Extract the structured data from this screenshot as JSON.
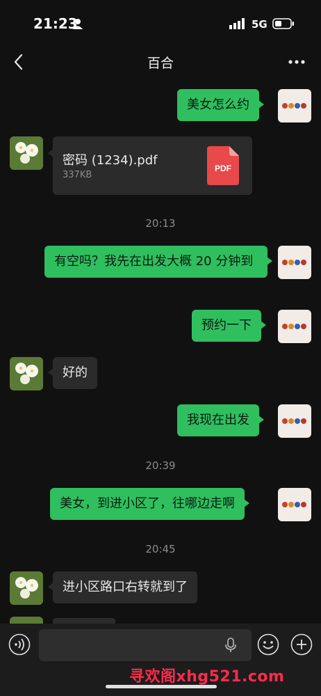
{
  "status_bar": {
    "time": "21:23",
    "network": "5G"
  },
  "header": {
    "title": "百合"
  },
  "messages": [
    {
      "text": "美女怎么约"
    },
    {
      "file_name": "密码 (1234).pdf",
      "file_size": "337KB",
      "file_icon_label": "PDF"
    },
    {
      "timestamp": "20:13"
    },
    {
      "text": "有空吗？我先在出发大概 20 分钟到"
    },
    {
      "text": "预约一下"
    },
    {
      "text": "好的"
    },
    {
      "text": "我现在出发"
    },
    {
      "timestamp": "20:39"
    },
    {
      "text": "美女，到进小区了，往哪边走啊"
    },
    {
      "timestamp": "20:45"
    },
    {
      "text": "进小区路口右转就到了"
    }
  ],
  "input": {
    "placeholder": ""
  },
  "watermark": "寻欢阁xhg521.com",
  "colors": {
    "outgoing_bubble": "#2fbf5f",
    "incoming_bubble": "#2b2b2b",
    "background": "#111111",
    "pdf_icon": "#e8494a"
  }
}
